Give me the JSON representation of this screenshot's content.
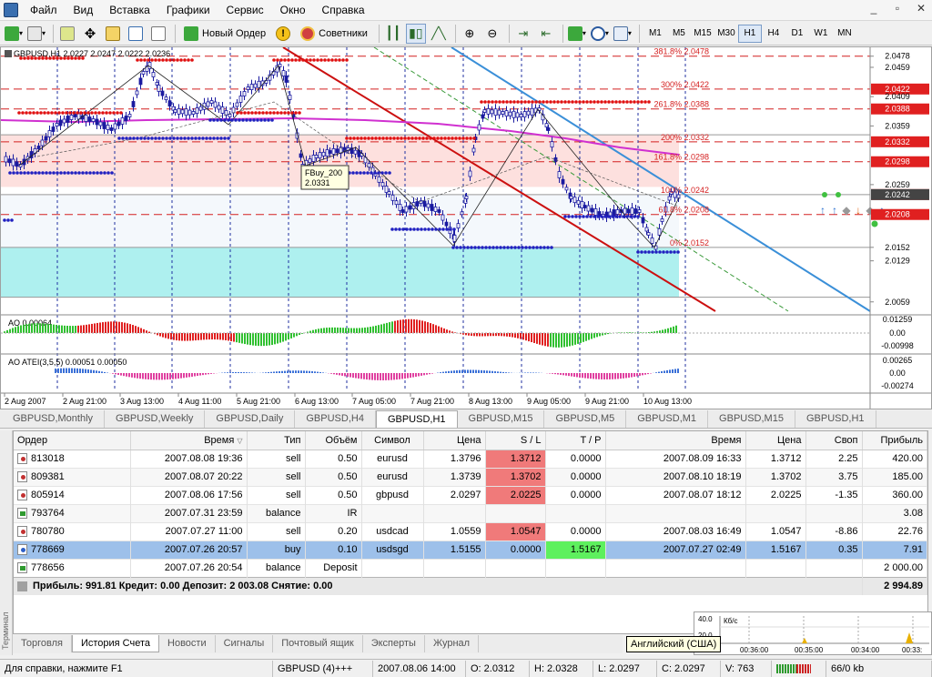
{
  "menu": [
    "Файл",
    "Вид",
    "Вставка",
    "Графики",
    "Сервис",
    "Окно",
    "Справка"
  ],
  "toolbar": {
    "new_order": "Новый Ордер",
    "advisors": "Советники"
  },
  "timeframes": [
    "M1",
    "M5",
    "M15",
    "M30",
    "H1",
    "H4",
    "D1",
    "W1",
    "MN"
  ],
  "active_timeframe": "H1",
  "chart": {
    "header": "GBPUSD,H1  2.0227 2.0247 2.0222 2.0236",
    "price_axis": [
      "2.0478",
      "2.0459",
      "2.0422",
      "2.0409",
      "2.0388",
      "2.0359",
      "2.0332",
      "2.0298",
      "2.0259",
      "2.0242",
      "2.0208",
      "2.0152",
      "2.0129",
      "2.0059"
    ],
    "fib_labels": [
      "381.8% 2.0478",
      "300% 2.0422",
      "261.8% 2.0388",
      "200% 2.0332",
      "161.8% 2.0298",
      "100% 2.0242",
      "61.8% 2.0208",
      "0% 2.0152"
    ],
    "callout_name": "FBuy_200",
    "callout_value": "2.0331",
    "ao_label": "AO 0.00064",
    "ao_axis": [
      "0.01259",
      "0.00",
      "-0.00998"
    ],
    "atei_label": "AO ATEI(3,5,5) 0.00051 0.00050",
    "atei_axis": [
      "0.00265",
      "0.00",
      "-0.00274"
    ],
    "time_axis": [
      "2 Aug 2007",
      "2 Aug 21:00",
      "3 Aug 13:00",
      "4 Aug 11:00",
      "5 Aug 21:00",
      "6 Aug 13:00",
      "7 Aug 05:00",
      "7 Aug 21:00",
      "8 Aug 13:00",
      "9 Aug 05:00",
      "9 Aug 21:00",
      "10 Aug 13:00"
    ]
  },
  "chart_tabs": [
    "GBPUSD,Monthly",
    "GBPUSD,Weekly",
    "GBPUSD,Daily",
    "GBPUSD,H4",
    "GBPUSD,H1",
    "GBPUSD,M15",
    "GBPUSD,M5",
    "GBPUSD,M1",
    "GBPUSD,M15",
    "GBPUSD,H1"
  ],
  "active_chart_tab": 4,
  "terminal": {
    "columns": [
      "Ордер",
      "Время",
      "Тип",
      "Объём",
      "Символ",
      "Цена",
      "S / L",
      "T / P",
      "Время",
      "Цена",
      "Своп",
      "Прибыль"
    ],
    "rows": [
      {
        "icon": "sell",
        "order": "813018",
        "open_time": "2007.08.08 19:36",
        "type": "sell",
        "volume": "0.50",
        "symbol": "eurusd",
        "price": "1.3796",
        "sl": "1.3712",
        "tp": "0.0000",
        "close_time": "2007.08.09 16:33",
        "close_price": "1.3712",
        "swap": "2.25",
        "profit": "420.00",
        "sl_hit": true,
        "tp_hit": false
      },
      {
        "icon": "sell",
        "order": "809381",
        "open_time": "2007.08.07 20:22",
        "type": "sell",
        "volume": "0.50",
        "symbol": "eurusd",
        "price": "1.3739",
        "sl": "1.3702",
        "tp": "0.0000",
        "close_time": "2007.08.10 18:19",
        "close_price": "1.3702",
        "swap": "3.75",
        "profit": "185.00",
        "sl_hit": true,
        "tp_hit": false
      },
      {
        "icon": "sell",
        "order": "805914",
        "open_time": "2007.08.06 17:56",
        "type": "sell",
        "volume": "0.50",
        "symbol": "gbpusd",
        "price": "2.0297",
        "sl": "2.0225",
        "tp": "0.0000",
        "close_time": "2007.08.07 18:12",
        "close_price": "2.0225",
        "swap": "-1.35",
        "profit": "360.00",
        "sl_hit": true,
        "tp_hit": false
      },
      {
        "icon": "bal",
        "order": "793764",
        "open_time": "2007.07.31 23:59",
        "type": "balance",
        "volume": "IR",
        "symbol": "",
        "price": "",
        "sl": "",
        "tp": "",
        "close_time": "",
        "close_price": "",
        "swap": "",
        "profit": "3.08",
        "sl_hit": false,
        "tp_hit": false
      },
      {
        "icon": "sell",
        "order": "780780",
        "open_time": "2007.07.27 11:00",
        "type": "sell",
        "volume": "0.20",
        "symbol": "usdcad",
        "price": "1.0559",
        "sl": "1.0547",
        "tp": "0.0000",
        "close_time": "2007.08.03 16:49",
        "close_price": "1.0547",
        "swap": "-8.86",
        "profit": "22.76",
        "sl_hit": true,
        "tp_hit": false
      },
      {
        "icon": "buy",
        "order": "778669",
        "open_time": "2007.07.26 20:57",
        "type": "buy",
        "volume": "0.10",
        "symbol": "usdsgd",
        "price": "1.5155",
        "sl": "0.0000",
        "tp": "1.5167",
        "close_time": "2007.07.27 02:49",
        "close_price": "1.5167",
        "swap": "0.35",
        "profit": "7.91",
        "sl_hit": false,
        "tp_hit": true,
        "selected": true
      },
      {
        "icon": "bal",
        "order": "778656",
        "open_time": "2007.07.26 20:54",
        "type": "balance",
        "volume": "Deposit",
        "symbol": "",
        "price": "",
        "sl": "",
        "tp": "",
        "close_time": "",
        "close_price": "",
        "swap": "",
        "profit": "2 000.00",
        "sl_hit": false,
        "tp_hit": false
      }
    ],
    "summary": "Прибыль: 991.81  Кредит: 0.00  Депозит: 2 003.08  Снятие: 0.00",
    "summary_total": "2 994.89",
    "side_label": "Терминал"
  },
  "terminal_tabs": [
    "Торговля",
    "История Счета",
    "Новости",
    "Сигналы",
    "Почтовый ящик",
    "Эксперты",
    "Журнал"
  ],
  "active_terminal_tab": 1,
  "kb_chart": {
    "label": "Кб/с",
    "y_max": "40.0",
    "y_min": "20.0",
    "times": [
      "00:36:00",
      "00:35:00",
      "00:34:00",
      "00:33:"
    ]
  },
  "tooltip": "Английский (США)",
  "status": {
    "help": "Для справки, нажмите F1",
    "profile": "GBPUSD (4)+++",
    "time": "2007.08.06 14:00",
    "open": "O: 2.0312",
    "high": "H: 2.0328",
    "low": "L: 2.0297",
    "close": "C: 2.0297",
    "volume": "V: 763",
    "traffic": "66/0 kb"
  },
  "colors": {
    "bull": "#1a1aa0",
    "bear": "#1a1aa0",
    "red_dash": "#d42020",
    "pink_zone": "#fde0de",
    "cyan_zone": "#aef0ef",
    "ao_green": "#30c030",
    "ao_red": "#e02020",
    "channel_red": "#cc1010",
    "channel_blue": "#3a8fd8"
  }
}
